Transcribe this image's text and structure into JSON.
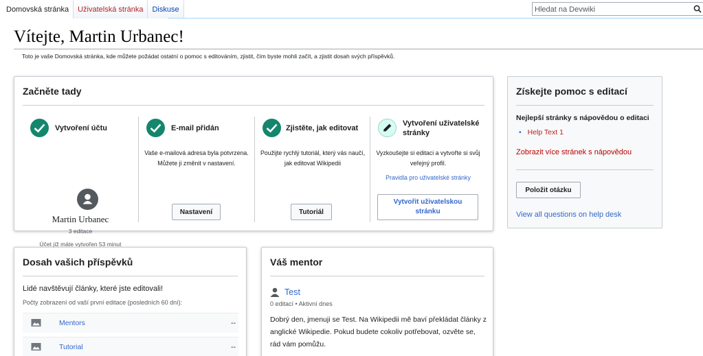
{
  "tabs": [
    {
      "label": "Domovská stránka"
    },
    {
      "label": "Uživatelská stránka"
    },
    {
      "label": "Diskuse"
    }
  ],
  "search": {
    "placeholder": "Hledat na Devwiki"
  },
  "page": {
    "title": "Vítejte, Martin Urbanec!",
    "subtitle": "Toto je vaše Domovská stránka, kde můžete požádat ostatní o pomoc s editováním, zjistit, čím byste mohli začít, a zjistit dosah svých příspěvků."
  },
  "start": {
    "title": "Začněte tady",
    "account": {
      "heading": "Vytvoření účtu",
      "user_name": "Martin Urbanec",
      "edits": "3 editace",
      "age": "Účet jíž máte vytvořen 53 minut"
    },
    "email": {
      "heading": "E-mail přidán",
      "text": "Vaše e-mailová adresa byla potvrzena. Můžete ji změnit v nastavení.",
      "button": "Nastavení"
    },
    "tutorial": {
      "heading": "Zjistěte, jak editovat",
      "text": "Použijte rychlý tutoriál, který vás naučí, jak editovat Wikipedii",
      "button": "Tutoriál"
    },
    "userpage": {
      "heading_line1": "Vytvoření uživatelské",
      "heading_line2": "stránky",
      "text": "Vyzkoušejte si editaci a vytvořte si svůj veřejný profil.",
      "link": "Pravidla pro uživatelské stránky",
      "button_line1": "Vytvořit uživatelskou",
      "button_line2": "stránku"
    }
  },
  "help": {
    "title": "Získejte pomoc s editací",
    "subheading": "Nejlepší stránky s nápovědou o editaci",
    "items": [
      "Help Text 1"
    ],
    "more_link": "Zobrazit více stránek s nápovědou",
    "ask_button": "Položit otázku",
    "desk_link": "View all questions on help desk"
  },
  "impact": {
    "title": "Dosah vašich příspěvků",
    "lead": "Lidé navštěvují články, které jste editovali!",
    "caption": "Počty zobrazení od vaší první editace (posledních 60 dní):",
    "rows": [
      {
        "page": "Mentors",
        "views": "--"
      },
      {
        "page": "Tutorial",
        "views": "--"
      }
    ]
  },
  "mentor": {
    "title": "Váš mentor",
    "name": "Test",
    "meta": "0 editací • Aktivní dnes",
    "text": "Dobrý den, jmenuji se Test. Na Wikipedii mě baví překládat články z anglické Wikipedie. Pokud budete cokoliv potřebovat, ozvěte se, rád vám pomůžu."
  },
  "colors": {
    "accent": "#3366cc",
    "success": "#14866d",
    "redlink": "#ba0000"
  }
}
